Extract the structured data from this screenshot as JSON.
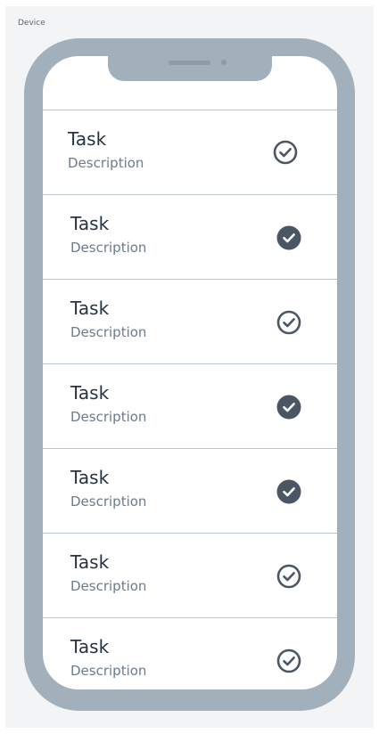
{
  "canvas": {
    "label": "Device"
  },
  "tasks": [
    {
      "title": "Task",
      "description": "Description",
      "completed": false
    },
    {
      "title": "Task",
      "description": "Description",
      "completed": true
    },
    {
      "title": "Task",
      "description": "Description",
      "completed": false
    },
    {
      "title": "Task",
      "description": "Description",
      "completed": true
    },
    {
      "title": "Task",
      "description": "Description",
      "completed": true
    },
    {
      "title": "Task",
      "description": "Description",
      "completed": false
    },
    {
      "title": "Task",
      "description": "Description",
      "completed": false
    }
  ],
  "icons": {
    "unchecked": "check-circle-outline-icon",
    "checked": "check-circle-filled-icon"
  },
  "colors": {
    "device_frame": "#a2b0bb",
    "canvas_bg": "#f2f4f6",
    "title_text": "#273240",
    "description_text": "#6b7c8d",
    "divider": "#b9c5cf",
    "check": "#4a5663"
  }
}
